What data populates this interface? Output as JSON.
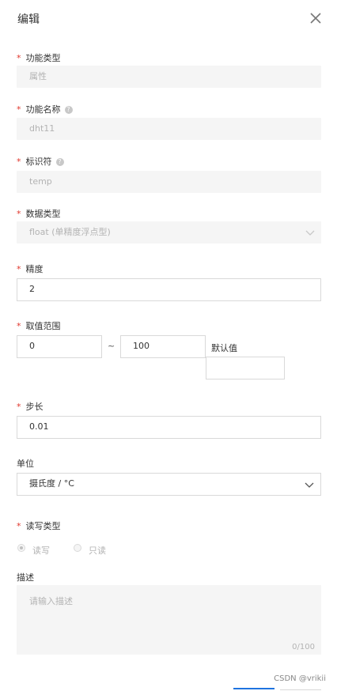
{
  "dialog": {
    "title": "编辑",
    "close_icon": "close-icon"
  },
  "required_mark": "*",
  "fields": {
    "function_type": {
      "label": "功能类型",
      "value": "属性"
    },
    "function_name": {
      "label": "功能名称",
      "value": "dht11",
      "help": "?"
    },
    "identifier": {
      "label": "标识符",
      "value": "temp",
      "help": "?"
    },
    "data_type": {
      "label": "数据类型",
      "value": "float (单精度浮点型)"
    },
    "precision": {
      "label": "精度",
      "value": "2"
    },
    "range": {
      "label": "取值范围",
      "min": "0",
      "separator": "~",
      "max": "100",
      "default_label": "默认值",
      "default_value": ""
    },
    "step": {
      "label": "步长",
      "value": "0.01"
    },
    "unit": {
      "label": "单位",
      "value": "摄氏度 / °C"
    },
    "rw_type": {
      "label": "读写类型",
      "options": [
        "读写",
        "只读"
      ],
      "selected": "读写"
    },
    "description": {
      "label": "描述",
      "placeholder": "请输入描述",
      "counter": "0/100"
    }
  },
  "watermark": "CSDN @vrikii"
}
